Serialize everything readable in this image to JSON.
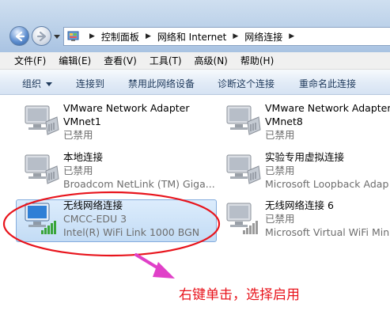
{
  "address_bar": {
    "breadcrumbs": [
      "控制面板",
      "网络和 Internet",
      "网络连接"
    ]
  },
  "menu": {
    "items": [
      "文件(F)",
      "编辑(E)",
      "查看(V)",
      "工具(T)",
      "高级(N)",
      "帮助(H)"
    ]
  },
  "toolbar": {
    "organize": "组织",
    "connect_to": "连接到",
    "disable": "禁用此网络设备",
    "diagnose": "诊断这个连接",
    "rename": "重命名此连接"
  },
  "adapters": [
    {
      "name": "VMware Network Adapter",
      "line2": "VMnet1",
      "line3": "已禁用"
    },
    {
      "name": "VMware Network Adapter",
      "line2": "VMnet8",
      "line3": "已禁用"
    },
    {
      "name": "本地连接",
      "line2": "已禁用",
      "line3": "Broadcom NetLink (TM) Giga..."
    },
    {
      "name": "实验专用虚拟连接",
      "line2": "已禁用",
      "line3": "Microsoft Loopback Adap"
    },
    {
      "name": "无线网络连接",
      "line2": "CMCC-EDU  3",
      "line3": "Intel(R) WiFi Link 1000 BGN"
    },
    {
      "name": "无线网络连接 6",
      "line2": "已禁用",
      "line3": "Microsoft Virtual WiFi Mini"
    }
  ],
  "annotation": {
    "text": "右键单击，选择启用",
    "color": "#e8141c"
  },
  "colors": {
    "selection": "#c3dcf5",
    "command_text": "#1e395b"
  }
}
